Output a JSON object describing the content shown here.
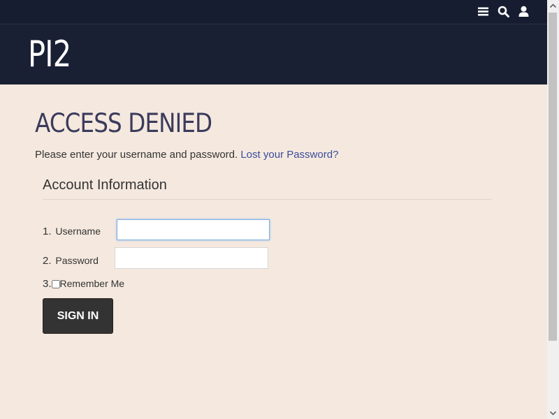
{
  "header": {
    "logo_text": "PI2"
  },
  "topbar": {
    "icons": [
      "menu-icon",
      "search-icon",
      "user-icon"
    ]
  },
  "main": {
    "title": "ACCESS DENIED",
    "instruction_text": "Please enter your username and password.",
    "lost_password_link": "Lost your Password?",
    "section_title": "Account Information",
    "fields": {
      "username": {
        "number": "1.",
        "label": "Username",
        "value": ""
      },
      "password": {
        "number": "2.",
        "label": "Password",
        "value": ""
      },
      "remember": {
        "number": "3.",
        "label": "Remember Me",
        "checked": false
      }
    },
    "signin_label": "SIGN IN"
  },
  "colors": {
    "page_bg": "#f5e9df",
    "header_bg": "#1a2034",
    "topbar_bg": "#161d30",
    "title_color": "#3b3b5c",
    "link_color": "#3a4c9b",
    "button_bg": "#333333"
  }
}
